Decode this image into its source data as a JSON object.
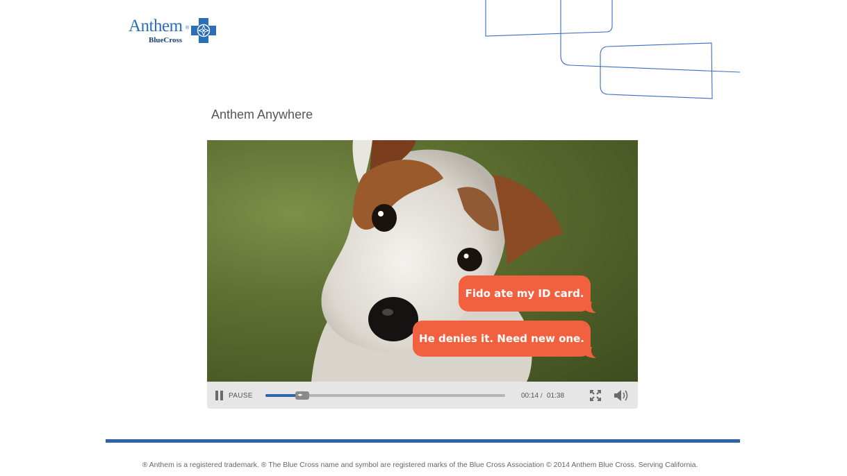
{
  "logo": {
    "word": "Anthem",
    "reg_mark": "®",
    "sub": "BlueCross",
    "cross_color": "#2a6fb8"
  },
  "page": {
    "title": "Anthem Anywhere"
  },
  "video": {
    "bubbles": [
      {
        "text": "Fido ate my ID card."
      },
      {
        "text": "He denies it. Need new one."
      }
    ],
    "bubble_color": "#f2613f",
    "controls": {
      "pause_label": "PAUSE",
      "current_time": "00:14",
      "separator": "/",
      "duration": "01:38",
      "progress_fraction": 0.143
    }
  },
  "footer": {
    "text": "® Anthem is a registered trademark. ® The Blue Cross name and symbol are registered marks of the Blue Cross Association © 2014 Anthem Blue Cross. Serving California.",
    "rule_color": "#2f62a8"
  }
}
